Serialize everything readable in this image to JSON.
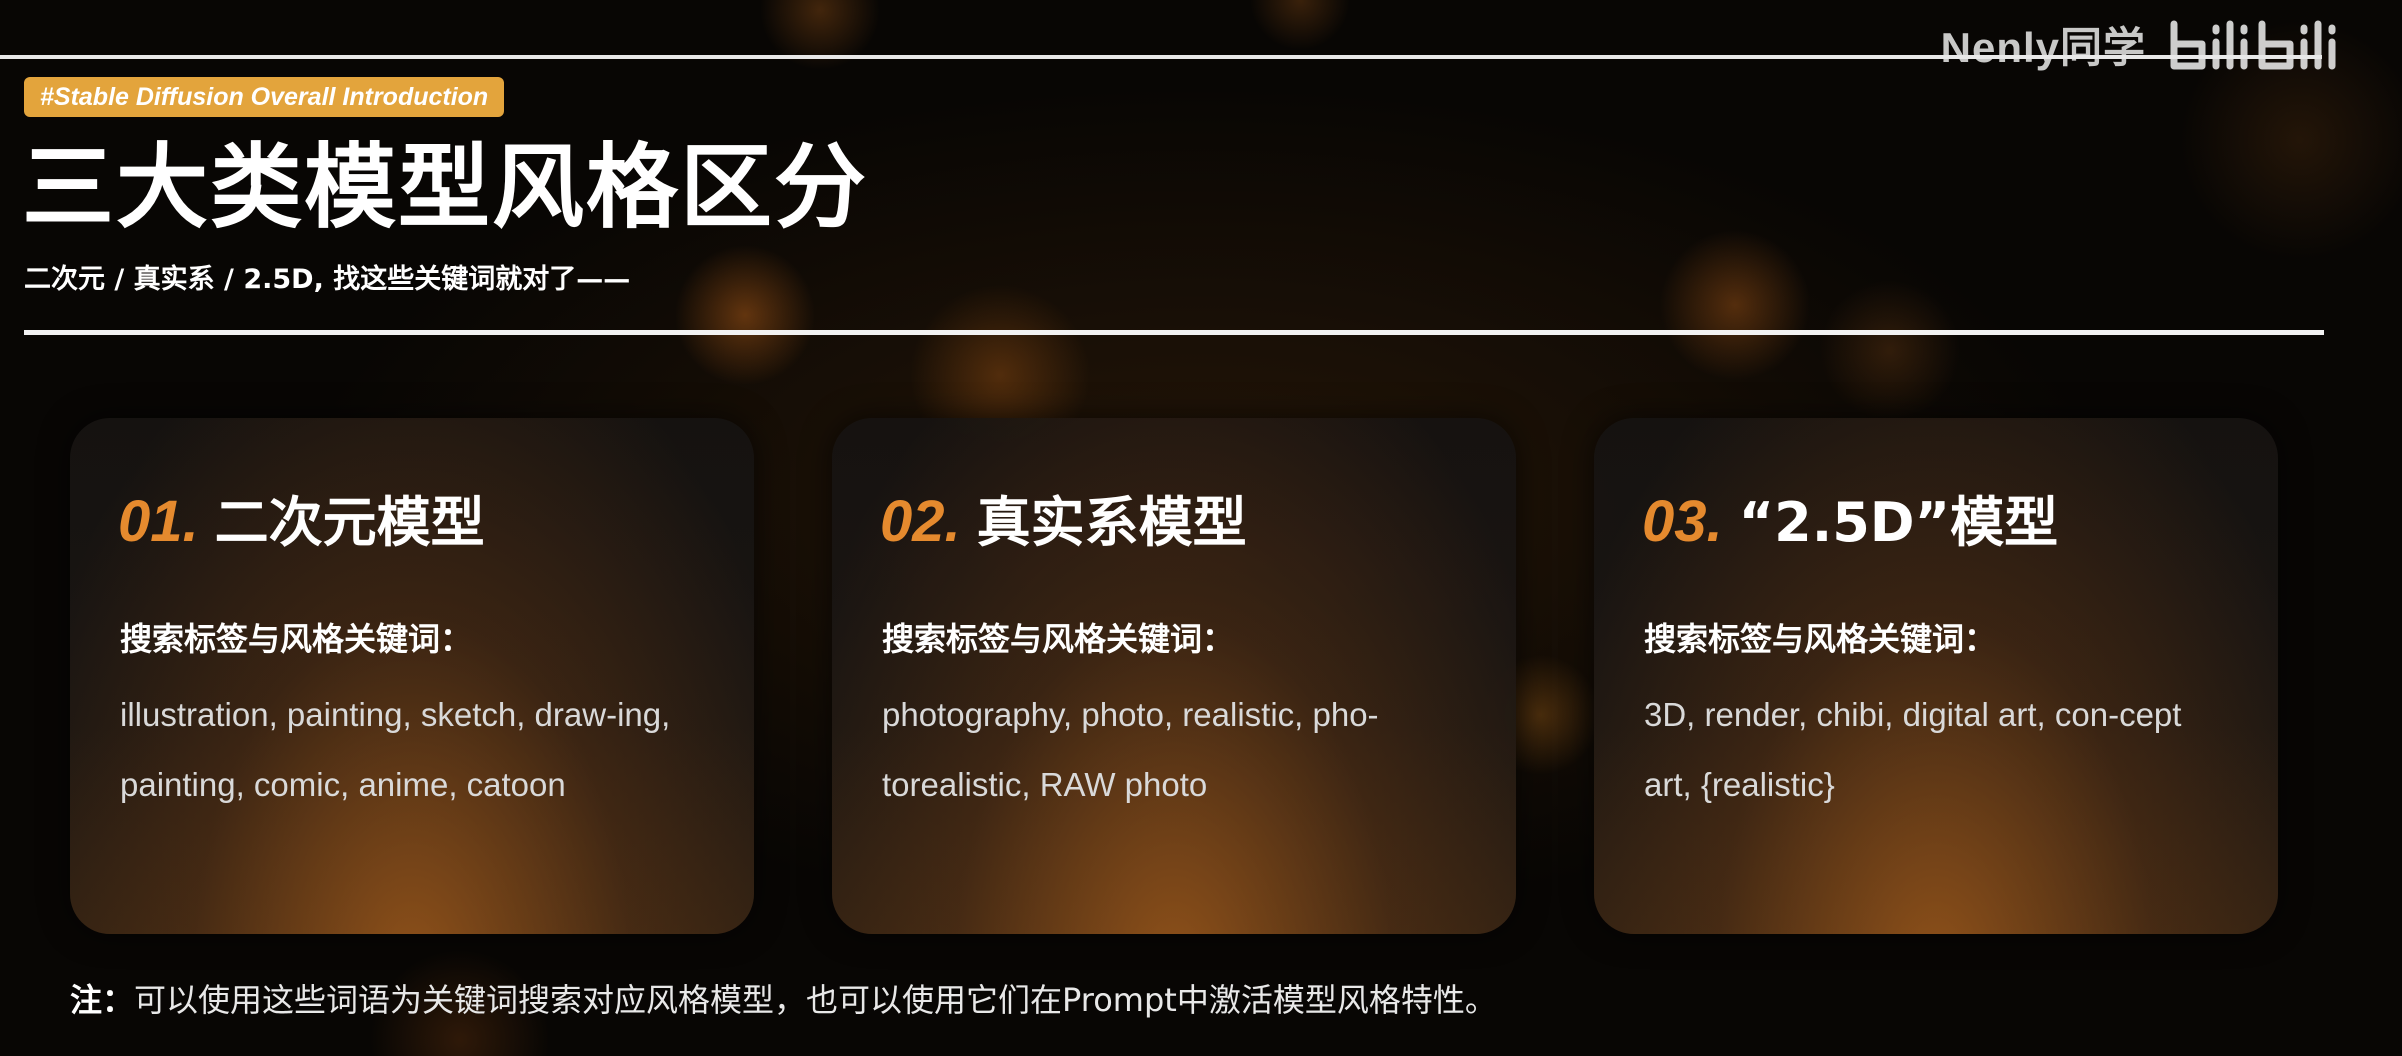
{
  "watermark": {
    "text": "Nenly同学",
    "logo_icon": "bilibili-logo-icon"
  },
  "header": {
    "tag": "#Stable Diffusion Overall Introduction",
    "title": "三大类模型风格区分",
    "subtitle": "二次元 / 真实系 / 2.5D, 找这些关键词就对了——"
  },
  "cards": [
    {
      "number": "01.",
      "title": "二次元模型",
      "label": "搜索标签与风格关键词：",
      "keywords": "illustration, painting, sketch, draw-ing, painting, comic, anime, catoon"
    },
    {
      "number": "02.",
      "title": "真实系模型",
      "label": "搜索标签与风格关键词：",
      "keywords": "photography, photo, realistic, pho-torealistic, RAW photo"
    },
    {
      "number": "03.",
      "title": "“2.5D”模型",
      "label": "搜索标签与风格关键词：",
      "keywords": "3D, render, chibi, digital art, con-cept art, {realistic}"
    }
  ],
  "note": {
    "label": "注：",
    "text": "可以使用这些词语为关键词搜索对应风格模型，也可以使用它们在Prompt中激活模型风格特性。"
  },
  "colors": {
    "accent_orange": "#e58a2e",
    "tag_background": "#e3a43c",
    "background": "#080604"
  }
}
